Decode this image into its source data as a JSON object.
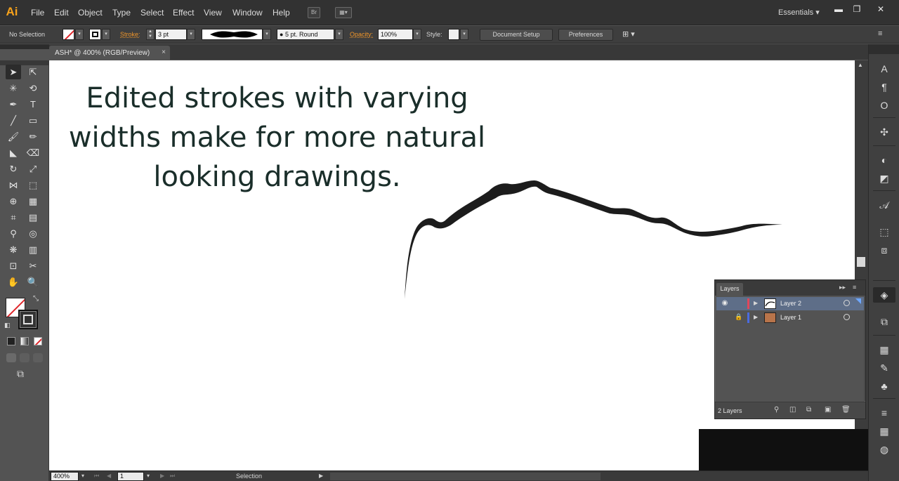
{
  "app": {
    "logo": "Ai",
    "menu": [
      "File",
      "Edit",
      "Object",
      "Type",
      "Select",
      "Effect",
      "View",
      "Window",
      "Help"
    ],
    "bridge_icon": "Br",
    "workspace": "Essentials",
    "window_controls": {
      "minimize": "▬",
      "restore": "❐",
      "close": "✕"
    }
  },
  "control_bar": {
    "selection_state": "No Selection",
    "stroke_label": "Stroke:",
    "stroke_weight": "3 pt",
    "brush_label": "5 pt. Round",
    "opacity_label": "Opacity:",
    "opacity_value": "100%",
    "style_label": "Style:",
    "document_setup": "Document Setup",
    "preferences": "Preferences"
  },
  "document": {
    "tab_title": "ASH* @ 400% (RGB/Preview)",
    "tab_close": "×",
    "canvas_text": [
      "Edited strokes with varying",
      "widths make for more natural",
      "looking drawings."
    ]
  },
  "tools": [
    {
      "name": "selection-tool",
      "glyph": "➤"
    },
    {
      "name": "direct-selection-tool",
      "glyph": "⇱"
    },
    {
      "name": "magic-wand-tool",
      "glyph": "✳"
    },
    {
      "name": "lasso-tool",
      "glyph": "⟲"
    },
    {
      "name": "pen-tool",
      "glyph": "✒"
    },
    {
      "name": "type-tool",
      "glyph": "T"
    },
    {
      "name": "line-segment-tool",
      "glyph": "╱"
    },
    {
      "name": "rectangle-tool",
      "glyph": "▭"
    },
    {
      "name": "paintbrush-tool",
      "glyph": "🖌"
    },
    {
      "name": "pencil-tool",
      "glyph": "✏"
    },
    {
      "name": "blob-brush-tool",
      "glyph": "◣"
    },
    {
      "name": "eraser-tool",
      "glyph": "⌫"
    },
    {
      "name": "rotate-tool",
      "glyph": "↻"
    },
    {
      "name": "scale-tool",
      "glyph": "⤢"
    },
    {
      "name": "width-tool",
      "glyph": "⋈"
    },
    {
      "name": "free-transform-tool",
      "glyph": "⬚"
    },
    {
      "name": "shape-builder-tool",
      "glyph": "⊕"
    },
    {
      "name": "perspective-grid-tool",
      "glyph": "▦"
    },
    {
      "name": "mesh-tool",
      "glyph": "⌗"
    },
    {
      "name": "gradient-tool",
      "glyph": "▤"
    },
    {
      "name": "eyedropper-tool",
      "glyph": "⚲"
    },
    {
      "name": "blend-tool",
      "glyph": "◎"
    },
    {
      "name": "symbol-sprayer-tool",
      "glyph": "❋"
    },
    {
      "name": "column-graph-tool",
      "glyph": "▥"
    },
    {
      "name": "artboard-tool",
      "glyph": "⊡"
    },
    {
      "name": "slice-tool",
      "glyph": "✂"
    },
    {
      "name": "hand-tool",
      "glyph": "✋"
    },
    {
      "name": "zoom-tool",
      "glyph": "🔍"
    }
  ],
  "status_bar": {
    "zoom": "400%",
    "artboard": "1",
    "current_tool": "Selection"
  },
  "layers_panel": {
    "tab": "Layers",
    "layers": [
      {
        "name": "Layer 2",
        "color": "#e0475b",
        "selected": true
      },
      {
        "name": "Layer 1",
        "color": "#4a6be0",
        "selected": false
      }
    ],
    "count": "2 Layers"
  },
  "dock_icons": [
    "character-icon",
    "paragraph-icon",
    "opentype-icon",
    "symbols-icon",
    "swatches-icon",
    "gradient-icon",
    "graphic-styles-icon",
    "transform-icon",
    "pathfinder-icon",
    "layers-icon",
    "artboards-icon",
    "align-icon",
    "brushes-icon",
    "symbol-library-icon",
    "stroke-icon",
    "transparency-icon",
    "appearance-icon"
  ],
  "colors": {
    "accent_orange": "#f0962a",
    "canvas": "#ffffff",
    "text": "#1a2e2a",
    "selected_layer": "#5e6e88"
  }
}
